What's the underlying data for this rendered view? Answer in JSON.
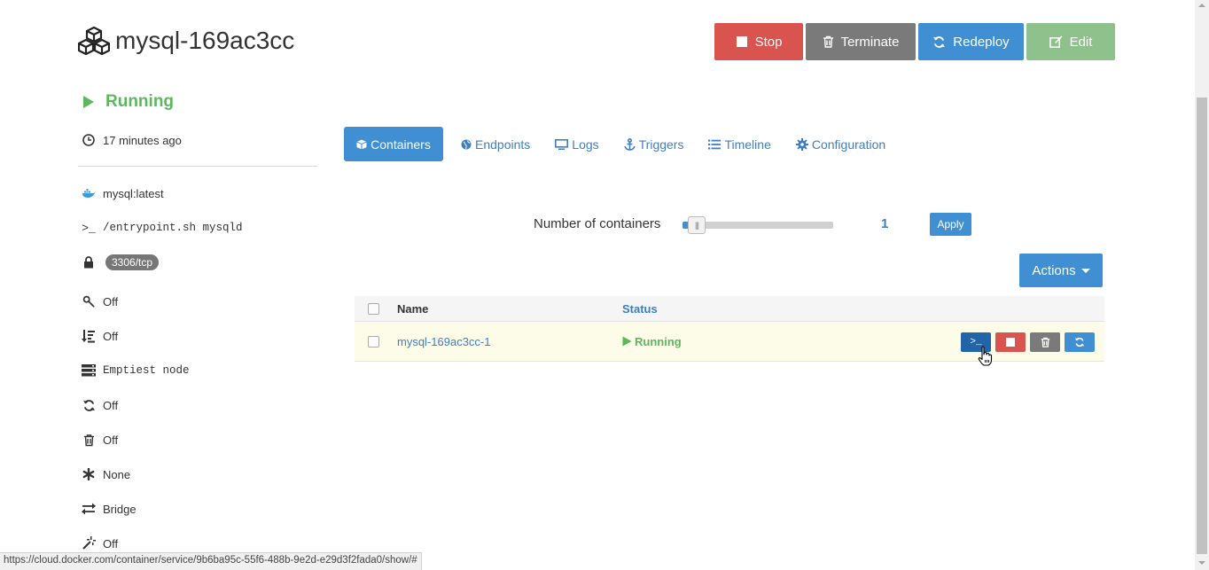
{
  "service": {
    "name": "mysql-169ac3cc",
    "status": "Running",
    "updated": "17 minutes ago"
  },
  "toolbar": {
    "stop_label": "Stop",
    "terminate_label": "Terminate",
    "redeploy_label": "Redeploy",
    "edit_label": "Edit"
  },
  "sidebar": {
    "image": "mysql:latest",
    "command": "/entrypoint.sh mysqld",
    "port": "3306/tcp",
    "autorestart": "Off",
    "sequential": "Off",
    "strategy": "Emptiest node",
    "autoredeploy": "Off",
    "autodestroy": "Off",
    "privileged": "None",
    "network": "Bridge",
    "extra": "Off"
  },
  "tabs": [
    {
      "label": "Containers"
    },
    {
      "label": "Endpoints"
    },
    {
      "label": "Logs"
    },
    {
      "label": "Triggers"
    },
    {
      "label": "Timeline"
    },
    {
      "label": "Configuration"
    }
  ],
  "scaler": {
    "label": "Number of containers",
    "value": "1",
    "level": 0.08,
    "apply_label": "Apply"
  },
  "actions_label": "Actions",
  "table": {
    "headers": {
      "name": "Name",
      "status": "Status"
    },
    "rows": [
      {
        "name": "mysql-169ac3cc-1",
        "status": "Running",
        "terminal_glyph": ">_"
      }
    ]
  },
  "statusbar": {
    "url": "https://cloud.docker.com/container/service/9b6ba95c-55f6-488b-9e2d-e29d3f2fada0/show/#"
  },
  "colors": {
    "danger": "#d9534f",
    "primary": "#3f8fd2",
    "success": "#5cb85c",
    "muted": "#7a7a7a",
    "edit": "#8fc18c"
  }
}
